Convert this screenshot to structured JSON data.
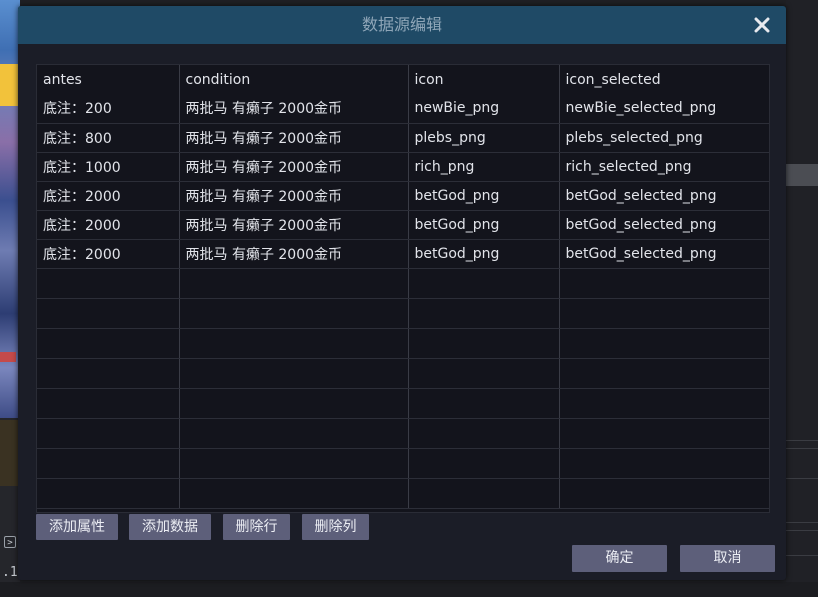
{
  "dialog": {
    "title": "数据源编辑",
    "close_icon": "close-icon"
  },
  "table": {
    "columns": [
      "antes",
      "condition",
      "icon",
      "icon_selected"
    ],
    "rows": [
      [
        "底注：200",
        "两批马 有癞子 2000金币",
        "newBie_png",
        "newBie_selected_png"
      ],
      [
        "底注：800",
        "两批马 有癞子 2000金币",
        "plebs_png",
        "plebs_selected_png"
      ],
      [
        "底注：1000",
        "两批马 有癞子 2000金币",
        "rich_png",
        "rich_selected_png"
      ],
      [
        "底注：2000",
        "两批马 有癞子 2000金币",
        "betGod_png",
        "betGod_selected_png"
      ],
      [
        "底注：2000",
        "两批马 有癞子 2000金币",
        "betGod_png",
        "betGod_selected_png"
      ],
      [
        "底注：2000",
        "两批马 有癞子 2000金币",
        "betGod_png",
        "betGod_selected_png"
      ]
    ],
    "empty_rows": 8
  },
  "buttons": {
    "add_attribute": "添加属性",
    "add_data": "添加数据",
    "delete_row": "删除行",
    "delete_column": "删除列",
    "confirm": "确定",
    "cancel": "取消"
  },
  "background": {
    "console_prompt_icon": "terminal-icon",
    "console_text": ".1"
  },
  "colors": {
    "titlebar": "#1f4a66",
    "button": "#5d5f7a",
    "grid_bg": "#13141c"
  }
}
